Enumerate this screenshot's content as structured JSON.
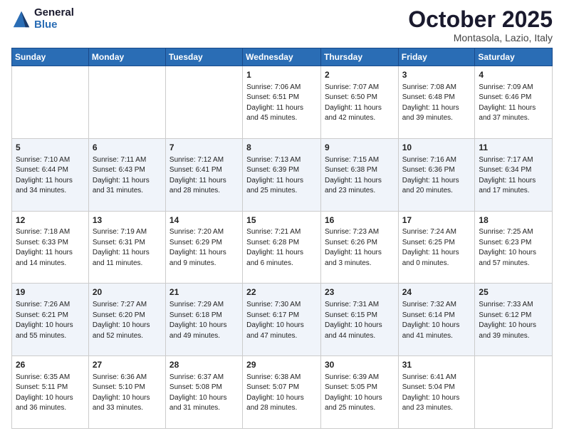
{
  "header": {
    "logo_general": "General",
    "logo_blue": "Blue",
    "month_title": "October 2025",
    "location": "Montasola, Lazio, Italy"
  },
  "weekdays": [
    "Sunday",
    "Monday",
    "Tuesday",
    "Wednesday",
    "Thursday",
    "Friday",
    "Saturday"
  ],
  "weeks": [
    [
      {
        "day": "",
        "info": ""
      },
      {
        "day": "",
        "info": ""
      },
      {
        "day": "",
        "info": ""
      },
      {
        "day": "1",
        "info": "Sunrise: 7:06 AM\nSunset: 6:51 PM\nDaylight: 11 hours\nand 45 minutes."
      },
      {
        "day": "2",
        "info": "Sunrise: 7:07 AM\nSunset: 6:50 PM\nDaylight: 11 hours\nand 42 minutes."
      },
      {
        "day": "3",
        "info": "Sunrise: 7:08 AM\nSunset: 6:48 PM\nDaylight: 11 hours\nand 39 minutes."
      },
      {
        "day": "4",
        "info": "Sunrise: 7:09 AM\nSunset: 6:46 PM\nDaylight: 11 hours\nand 37 minutes."
      }
    ],
    [
      {
        "day": "5",
        "info": "Sunrise: 7:10 AM\nSunset: 6:44 PM\nDaylight: 11 hours\nand 34 minutes."
      },
      {
        "day": "6",
        "info": "Sunrise: 7:11 AM\nSunset: 6:43 PM\nDaylight: 11 hours\nand 31 minutes."
      },
      {
        "day": "7",
        "info": "Sunrise: 7:12 AM\nSunset: 6:41 PM\nDaylight: 11 hours\nand 28 minutes."
      },
      {
        "day": "8",
        "info": "Sunrise: 7:13 AM\nSunset: 6:39 PM\nDaylight: 11 hours\nand 25 minutes."
      },
      {
        "day": "9",
        "info": "Sunrise: 7:15 AM\nSunset: 6:38 PM\nDaylight: 11 hours\nand 23 minutes."
      },
      {
        "day": "10",
        "info": "Sunrise: 7:16 AM\nSunset: 6:36 PM\nDaylight: 11 hours\nand 20 minutes."
      },
      {
        "day": "11",
        "info": "Sunrise: 7:17 AM\nSunset: 6:34 PM\nDaylight: 11 hours\nand 17 minutes."
      }
    ],
    [
      {
        "day": "12",
        "info": "Sunrise: 7:18 AM\nSunset: 6:33 PM\nDaylight: 11 hours\nand 14 minutes."
      },
      {
        "day": "13",
        "info": "Sunrise: 7:19 AM\nSunset: 6:31 PM\nDaylight: 11 hours\nand 11 minutes."
      },
      {
        "day": "14",
        "info": "Sunrise: 7:20 AM\nSunset: 6:29 PM\nDaylight: 11 hours\nand 9 minutes."
      },
      {
        "day": "15",
        "info": "Sunrise: 7:21 AM\nSunset: 6:28 PM\nDaylight: 11 hours\nand 6 minutes."
      },
      {
        "day": "16",
        "info": "Sunrise: 7:23 AM\nSunset: 6:26 PM\nDaylight: 11 hours\nand 3 minutes."
      },
      {
        "day": "17",
        "info": "Sunrise: 7:24 AM\nSunset: 6:25 PM\nDaylight: 11 hours\nand 0 minutes."
      },
      {
        "day": "18",
        "info": "Sunrise: 7:25 AM\nSunset: 6:23 PM\nDaylight: 10 hours\nand 57 minutes."
      }
    ],
    [
      {
        "day": "19",
        "info": "Sunrise: 7:26 AM\nSunset: 6:21 PM\nDaylight: 10 hours\nand 55 minutes."
      },
      {
        "day": "20",
        "info": "Sunrise: 7:27 AM\nSunset: 6:20 PM\nDaylight: 10 hours\nand 52 minutes."
      },
      {
        "day": "21",
        "info": "Sunrise: 7:29 AM\nSunset: 6:18 PM\nDaylight: 10 hours\nand 49 minutes."
      },
      {
        "day": "22",
        "info": "Sunrise: 7:30 AM\nSunset: 6:17 PM\nDaylight: 10 hours\nand 47 minutes."
      },
      {
        "day": "23",
        "info": "Sunrise: 7:31 AM\nSunset: 6:15 PM\nDaylight: 10 hours\nand 44 minutes."
      },
      {
        "day": "24",
        "info": "Sunrise: 7:32 AM\nSunset: 6:14 PM\nDaylight: 10 hours\nand 41 minutes."
      },
      {
        "day": "25",
        "info": "Sunrise: 7:33 AM\nSunset: 6:12 PM\nDaylight: 10 hours\nand 39 minutes."
      }
    ],
    [
      {
        "day": "26",
        "info": "Sunrise: 6:35 AM\nSunset: 5:11 PM\nDaylight: 10 hours\nand 36 minutes."
      },
      {
        "day": "27",
        "info": "Sunrise: 6:36 AM\nSunset: 5:10 PM\nDaylight: 10 hours\nand 33 minutes."
      },
      {
        "day": "28",
        "info": "Sunrise: 6:37 AM\nSunset: 5:08 PM\nDaylight: 10 hours\nand 31 minutes."
      },
      {
        "day": "29",
        "info": "Sunrise: 6:38 AM\nSunset: 5:07 PM\nDaylight: 10 hours\nand 28 minutes."
      },
      {
        "day": "30",
        "info": "Sunrise: 6:39 AM\nSunset: 5:05 PM\nDaylight: 10 hours\nand 25 minutes."
      },
      {
        "day": "31",
        "info": "Sunrise: 6:41 AM\nSunset: 5:04 PM\nDaylight: 10 hours\nand 23 minutes."
      },
      {
        "day": "",
        "info": ""
      }
    ]
  ]
}
